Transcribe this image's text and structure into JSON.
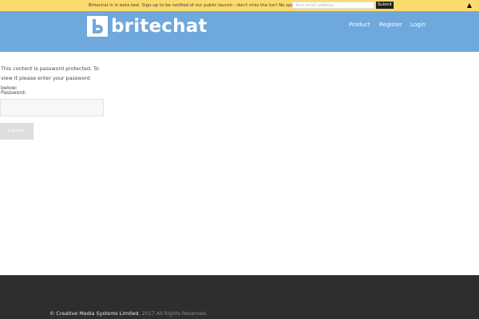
{
  "notice_bar": {
    "message": "Britechat is in beta test. Sign-up to be notified of our public launch - don't miss the fun! No spam we promise.",
    "email_placeholder": "Your email address...",
    "submit_label": "Submit",
    "toggle_glyph": "▲"
  },
  "header": {
    "logo_text": "britechat",
    "nav": [
      "Product",
      "Register",
      "Login"
    ]
  },
  "main": {
    "protected_message": "This content is password protected. To view it please enter your password below:",
    "password_label": "Password:",
    "enter_label": "ENTER"
  },
  "footer": {
    "copyright_owner": "© Creative Media Systems Limited.",
    "copyright_rights": " 2017 All Rights Reserved."
  },
  "colors": {
    "notice_bg": "#fcdb6e",
    "header_bg": "#6fa8dc",
    "footer_bg": "#2e2e2e",
    "button_bg": "#dedede"
  }
}
